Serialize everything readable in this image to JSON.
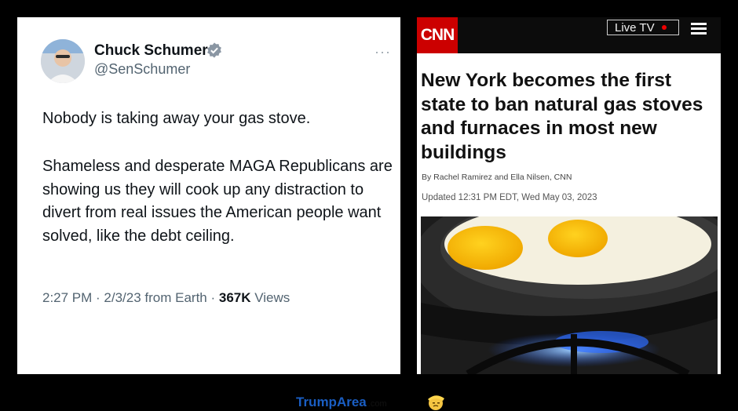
{
  "tweet": {
    "name": "Chuck Schumer",
    "handle": "@SenSchumer",
    "line1": "Nobody is taking away your gas stove.",
    "paragraph": "Shameless and desperate MAGA Republicans are showing us they will cook up any distraction to divert from real issues the American people want solved, like the debt ceiling.",
    "time": "2:27 PM · 2/3/23 from Earth · ",
    "views_count": "367K",
    "views_label": " Views",
    "more_label": "···"
  },
  "cnn": {
    "logo": "CNN",
    "live_tv": "Live TV",
    "headline": "New York becomes the first state to ban natural gas stoves and furnaces in most new buildings",
    "byline": "By Rachel Ramirez and Ella Nilsen, CNN",
    "updated": "Updated 12:31 PM EDT, Wed May 03, 2023"
  },
  "footer": {
    "brand_trump": "Trump",
    "brand_area": "Area",
    "brand_com": ".com"
  },
  "colors": {
    "cnn_red": "#cc0000",
    "verified_blue": "#1d9bf0",
    "brand_blue": "#1a5ec3"
  }
}
